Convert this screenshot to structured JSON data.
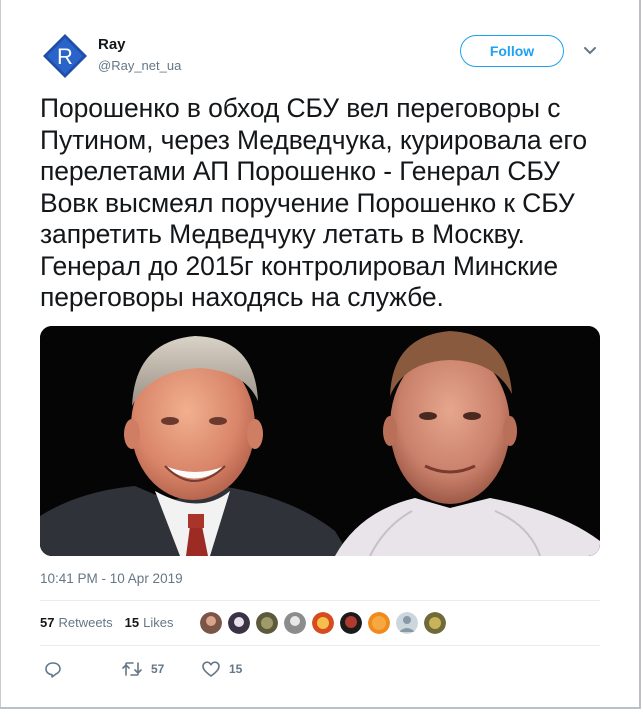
{
  "author": {
    "name": "Ray",
    "handle": "@Ray_net_ua",
    "avatar_letter": "R",
    "avatar_color": "#1f4fa8"
  },
  "follow_label": "Follow",
  "tweet_text": "Порошенко в обход СБУ вел переговоры с Путином, через Медведчука, курировала его перелетами АП Порошенко - Генерал СБУ Вовк высмеял поручение Порошенко к СБУ запретить Медведчуку летать в Москву. Генерал до 2015г контролировал Минские переговоры находясь на службе.",
  "timestamp": "10:41 PM - 10 Apr 2019",
  "stats": {
    "retweets_count": "57",
    "retweets_label": "Retweets",
    "likes_count": "15",
    "likes_label": "Likes"
  },
  "actions": {
    "reply_icon": "reply-icon",
    "retweet_icon": "retweet-icon",
    "retweet_count": "57",
    "like_icon": "heart-icon",
    "like_count": "15"
  },
  "colors": {
    "accent": "#1da1f2",
    "secondary_text": "#657786",
    "retweet_green": "#17bf63"
  }
}
